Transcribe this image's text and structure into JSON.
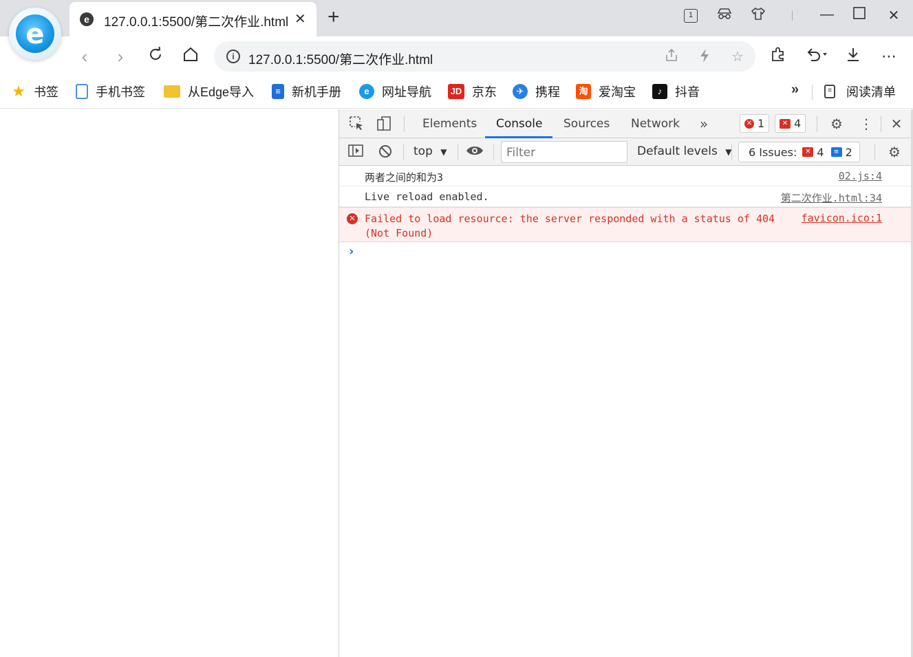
{
  "browser": {
    "tab": {
      "favicon": "e",
      "title": "127.0.0.1:5500/第二次作业.html",
      "close": "✕"
    },
    "new_tab": "+",
    "window_controls": {
      "tab_count": "1",
      "minimize": "—",
      "maximize": "☐",
      "close": "✕"
    },
    "address": {
      "url": "127.0.0.1:5500/第二次作业.html",
      "info": "i"
    },
    "bookmarks": [
      {
        "label": "书签",
        "icon": "star-icon",
        "color": "#f5b400"
      },
      {
        "label": "手机书签",
        "icon": "phone-bookmark-icon",
        "color": "#4a90e2"
      },
      {
        "label": "从Edge导入",
        "icon": "folder-icon",
        "color": "#f2c230"
      },
      {
        "label": "新机手册",
        "icon": "manual-icon",
        "color": "#1e6fd9"
      },
      {
        "label": "网址导航",
        "icon": "nav-e-icon",
        "color": "#1a9be6"
      },
      {
        "label": "京东",
        "icon": "jd-icon",
        "color": "#e1251b"
      },
      {
        "label": "携程",
        "icon": "ctrip-icon",
        "color": "#2a7fe0"
      },
      {
        "label": "爱淘宝",
        "icon": "taobao-icon",
        "color": "#ff5000"
      },
      {
        "label": "抖音",
        "icon": "douyin-icon",
        "color": "#111111"
      }
    ],
    "reading_list": "阅读清单",
    "more": "»"
  },
  "devtools": {
    "tabs": [
      "Elements",
      "Console",
      "Sources",
      "Network"
    ],
    "active_tab": "Console",
    "more_tabs": "»",
    "error_count": "1",
    "warning_count": "4",
    "context": "top",
    "filter_placeholder": "Filter",
    "levels": "Default levels",
    "issues_label": "6 Issues:",
    "issues_errors": "4",
    "issues_info": "2",
    "messages": [
      {
        "text": "两者之间的和为3",
        "source": "02.js:4",
        "level": "log"
      },
      {
        "text": "Live reload enabled.",
        "source": "第二次作业.html:34",
        "level": "log"
      },
      {
        "text": "Failed to load resource: the server responded with a status of 404 (Not Found)",
        "source": "favicon.ico:1",
        "level": "error"
      }
    ],
    "prompt": "›"
  }
}
